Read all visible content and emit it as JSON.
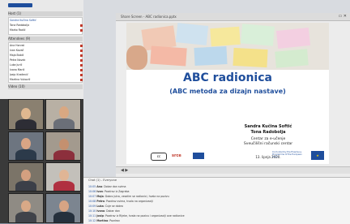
{
  "left_panel": {
    "header1": "Host (1)",
    "header2": "Attendees (9)",
    "hosts": [
      "Sandra Kučina Softić",
      "Tona Radobolja",
      "Marko Radić"
    ],
    "attendees": [
      "Ana Horvat",
      "Ivan Kovač",
      "Maja Babić",
      "Petra Novak",
      "Luka Jurić",
      "Ivana Marić",
      "Josip Knežević",
      "Martina Vuković"
    ],
    "video_header": "Video (10)"
  },
  "share": {
    "title": "Share Screen - ABC radionica.pptx"
  },
  "slide": {
    "title": "ABC radionica",
    "subtitle": "(ABC metoda za dizajn nastave)",
    "author1": "Sandra Kučina Softić",
    "author2": "Tona Radobolja",
    "org1": "Centar za e-učenje",
    "org2": "Sveučilišni računski centar",
    "date": "13. lipnja 2020.",
    "eu_text": "Co-funded by the Erasmus+ Programme of the European Union",
    "logo1": "cc",
    "logo2": "srce"
  },
  "chat": {
    "header": "Chat (1) - Everyone",
    "lines": [
      {
        "time": "10:05",
        "name": "Ana",
        "text": "Dobar dan svima"
      },
      {
        "time": "10:06",
        "name": "Ivan",
        "text": "Pozdrav iz Zagreba"
      },
      {
        "time": "10:07",
        "name": "Maja",
        "text": "Dobro jutro, veselim se radionici, hvala na pozivu"
      },
      {
        "time": "10:08",
        "name": "Petra",
        "text": "Pozdrav svima, hvala na organizaciji"
      },
      {
        "time": "10:09",
        "name": "Luka",
        "text": "Čuje se dobro"
      },
      {
        "time": "10:10",
        "name": "Ivana",
        "text": "Dobar dan"
      },
      {
        "time": "10:11",
        "name": "Josip",
        "text": "Pozdrav iz Rijeke, hvala na pozivu i organizaciji ove radionice"
      },
      {
        "time": "10:12",
        "name": "Martina",
        "text": "Pozdrav"
      }
    ]
  }
}
